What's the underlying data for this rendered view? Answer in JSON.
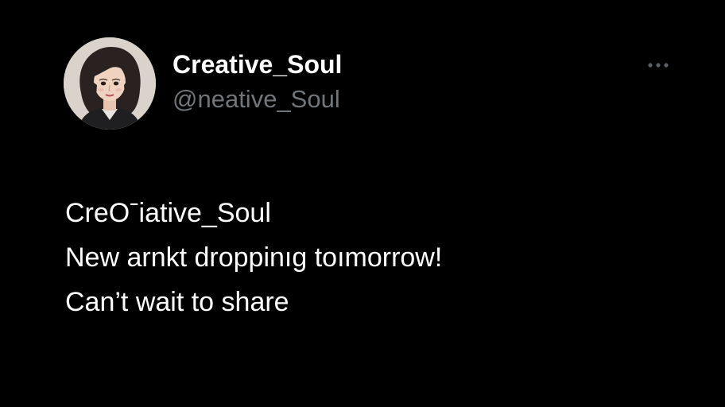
{
  "post": {
    "author": {
      "display_name": "Creative_Soul",
      "handle": "@neative_Soul",
      "avatar_icon": "profile-avatar-woman"
    },
    "menu": {
      "icon": "more-options-icon"
    },
    "text_lines": [
      "CreOˉiative_Soul",
      "New arnkt droppinıg toımorrow!",
      "Can’t wait to share"
    ]
  },
  "colors": {
    "background": "#000000",
    "name": "#ffffff",
    "handle": "#71767b",
    "body_text": "#ffffff",
    "menu_dots": "#5b6066"
  }
}
